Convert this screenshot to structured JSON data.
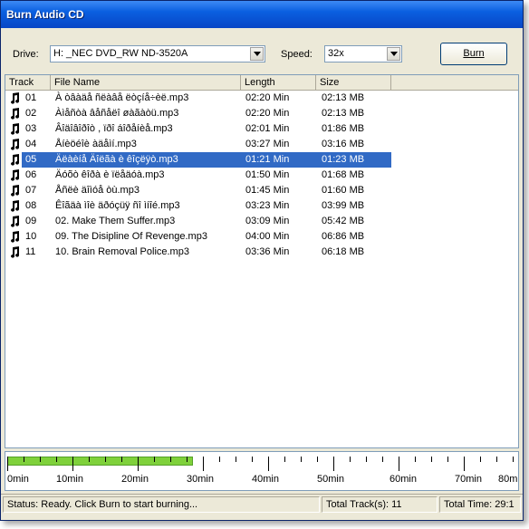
{
  "window": {
    "title": "Burn Audio CD"
  },
  "controls": {
    "drive_label": "Drive:",
    "drive_value": "H: _NEC DVD_RW ND-3520A",
    "speed_label": "Speed:",
    "speed_value": "32x",
    "burn_label": "Burn"
  },
  "list": {
    "columns": [
      "Track",
      "File Name",
      "Length",
      "Size"
    ],
    "rows": [
      {
        "track": "01",
        "file": "À òâàäå ñëàâå ëòçíå÷èë.mp3",
        "length": "02:20 Min",
        "size": "02:13 MB"
      },
      {
        "track": "02",
        "file": "Àìåñòà âåñåëî øàãàòü.mp3",
        "length": "02:20 Min",
        "size": "02:13 MB"
      },
      {
        "track": "03",
        "file": "Âîäîâîðîò , ïðî áîðåíèå.mp3",
        "length": "02:01 Min",
        "size": "01:86 MB"
      },
      {
        "track": "04",
        "file": "Åíèöéîè àäåìí.mp3",
        "length": "03:27 Min",
        "size": "03:16 MB"
      },
      {
        "track": "05",
        "file": "Äëàèíå Äîëãà è êîçëÿò.mp3",
        "length": "01:21 Min",
        "size": "01:23 MB"
      },
      {
        "track": "06",
        "file": "Äóõò êîðà è ïëåäóà.mp3",
        "length": "01:50 Min",
        "size": "01:68 MB"
      },
      {
        "track": "07",
        "file": "Åñëè äîìóå òù.mp3",
        "length": "01:45 Min",
        "size": "01:60 MB"
      },
      {
        "track": "08",
        "file": "Êîãäà ìîè äðóçüÿ ñî ìíîé.mp3",
        "length": "03:23 Min",
        "size": "03:99 MB"
      },
      {
        "track": "09",
        "file": "02. Make Them Suffer.mp3",
        "length": "03:09 Min",
        "size": "05:42 MB"
      },
      {
        "track": "10",
        "file": "09. The Disipline Of Revenge.mp3",
        "length": "04:00 Min",
        "size": "06:86 MB"
      },
      {
        "track": "11",
        "file": "10. Brain Removal Police.mp3",
        "length": "03:36 Min",
        "size": "06:18 MB"
      }
    ],
    "selected_index": 4
  },
  "timeline": {
    "labels": [
      "0min",
      "10min",
      "20min",
      "30min",
      "40min",
      "50min",
      "60min",
      "70min",
      "80min"
    ],
    "progress_fraction": 0.365,
    "progress_color": "#7fd13b"
  },
  "status": {
    "message": "Status: Ready. Click Burn to start burning...",
    "total_tracks": "Total Track(s): 11",
    "total_time": "Total Time: 29:1"
  },
  "colors": {
    "titlebar": "#0a5fe0",
    "selection": "#316ac5",
    "window_bg": "#ece9d8"
  },
  "icons": {
    "track_icon": "music-note-icon",
    "dropdown_icon": "chevron-down-icon"
  }
}
